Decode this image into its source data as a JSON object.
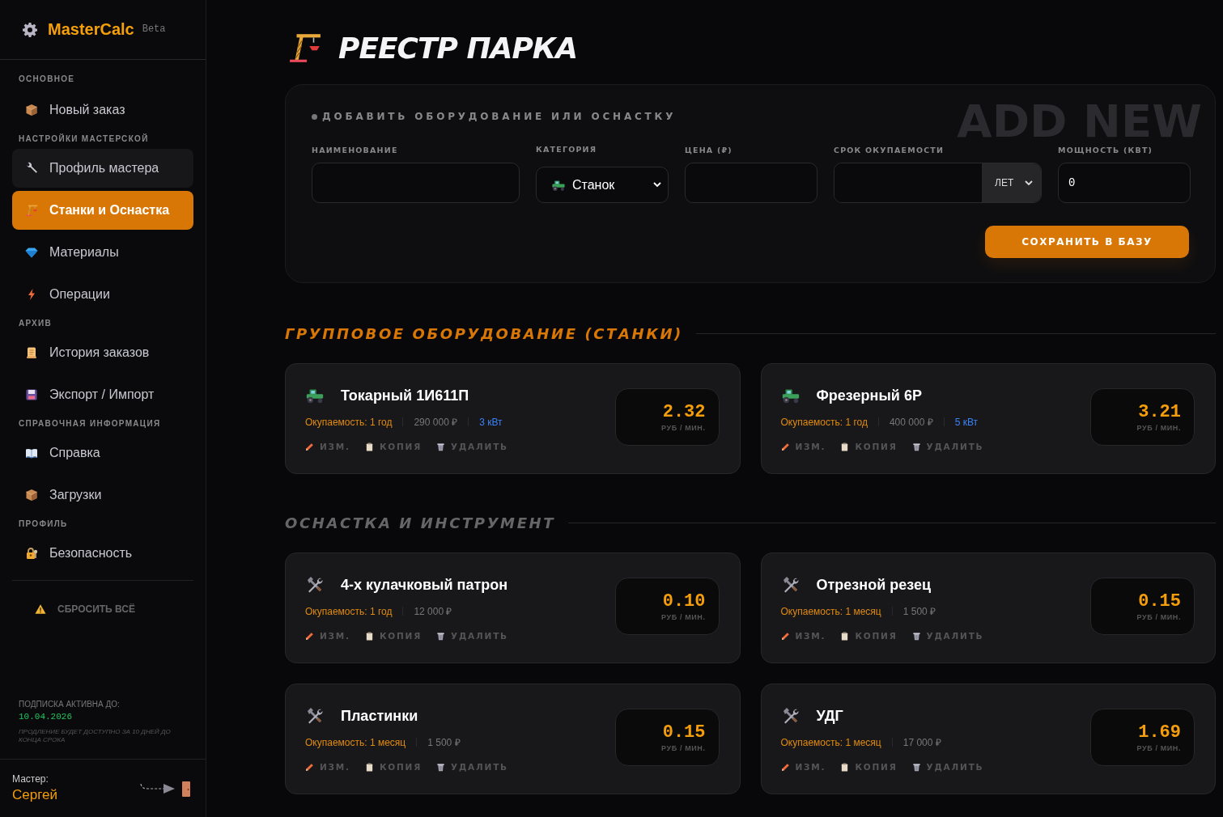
{
  "brand": {
    "name": "MasterCalc",
    "badge": "Beta"
  },
  "sidebar": {
    "sections": [
      {
        "heading": "ОСНОВНОЕ",
        "items": [
          {
            "label": "Новый заказ",
            "kind": "box",
            "selected": false,
            "hovered": false
          }
        ]
      },
      {
        "heading": "НАСТРОЙКИ МАСТЕРСКОЙ",
        "items": [
          {
            "label": "Профиль мастера",
            "kind": "wrench",
            "selected": false,
            "hovered": true
          },
          {
            "label": "Станки и Оснастка",
            "kind": "crane",
            "selected": true,
            "hovered": false
          },
          {
            "label": "Материалы",
            "kind": "gem",
            "selected": false,
            "hovered": false
          },
          {
            "label": "Операции",
            "kind": "lightning",
            "selected": false,
            "hovered": false
          }
        ]
      },
      {
        "heading": "АРХИВ",
        "items": [
          {
            "label": "История заказов",
            "kind": "scroll",
            "selected": false,
            "hovered": false
          },
          {
            "label": "Экспорт / Импорт",
            "kind": "floppy",
            "selected": false,
            "hovered": false
          }
        ]
      },
      {
        "heading": "СПРАВОЧНАЯ ИНФОРМАЦИЯ",
        "items": [
          {
            "label": "Справка",
            "kind": "book",
            "selected": false,
            "hovered": false
          },
          {
            "label": "Загрузки",
            "kind": "box",
            "selected": false,
            "hovered": false
          }
        ]
      },
      {
        "heading": "ПРОФИЛЬ",
        "items": [
          {
            "label": "Безопасность",
            "kind": "lock",
            "selected": false,
            "hovered": false
          }
        ]
      }
    ],
    "reset_button": "СБРОСИТЬ ВСЁ",
    "subscription": {
      "label": "ПОДПИСКА АКТИВНА ДО:",
      "date": "10.04.2026",
      "note": "ПРОДЛЕНИЕ БУДЕТ ДОСТУПНО ЗА 10 ДНЕЙ ДО КОНЦА СРОКА"
    },
    "user": {
      "label": "Мастер:",
      "name": "Сергей"
    }
  },
  "page": {
    "title": "РЕЕСТР ПАРКА"
  },
  "add_form": {
    "title": "ДОБАВИТЬ ОБОРУДОВАНИЕ ИЛИ ОСНАСТКУ",
    "watermark": "ADD NEW",
    "fields": [
      {
        "kind": "text",
        "label": "НАИМЕНОВАНИЕ"
      },
      {
        "kind": "select",
        "label": "КАТЕГОРИЯ",
        "value": "Станок"
      },
      {
        "kind": "text",
        "label": "ЦЕНА (₽)"
      },
      {
        "kind": "unit",
        "label": "СРОК ОКУПАЕМОСТИ",
        "unit": "ЛЕТ"
      },
      {
        "kind": "text",
        "label": "МОЩНОСТЬ (КВТ)",
        "value": "0"
      }
    ],
    "save_button": "СОХРАНИТЬ В БАЗУ"
  },
  "groups": [
    {
      "title": "ГРУППОВОЕ ОБОРУДОВАНИЕ (СТАНКИ)",
      "highlighted": true,
      "items": [
        {
          "kind": "machine",
          "name": "Токарный 1И611П",
          "payback": "Окупаемость: 1 год",
          "price": "290 000 ₽",
          "power": "3 кВт",
          "rate": "2.32",
          "rate_unit": "РУБ / МИН.",
          "actions": [
            "ИЗМ.",
            "КОПИЯ",
            "УДАЛИТЬ"
          ]
        },
        {
          "kind": "machine",
          "name": "Фрезерный 6Р",
          "payback": "Окупаемость: 1 год",
          "price": "400 000 ₽",
          "power": "5 кВт",
          "rate": "3.21",
          "rate_unit": "РУБ / МИН.",
          "actions": [
            "ИЗМ.",
            "КОПИЯ",
            "УДАЛИТЬ"
          ]
        }
      ]
    },
    {
      "title": "ОСНАСТКА И ИНСТРУМЕНТ",
      "highlighted": false,
      "items": [
        {
          "kind": "tool",
          "name": "4-х кулачковый патрон",
          "payback": "Окупаемость: 1 год",
          "price": "12 000 ₽",
          "rate": "0.10",
          "rate_unit": "РУБ / МИН.",
          "actions": [
            "ИЗМ.",
            "КОПИЯ",
            "УДАЛИТЬ"
          ]
        },
        {
          "kind": "tool",
          "name": "Отрезной резец",
          "payback": "Окупаемость: 1 месяц",
          "price": "1 500 ₽",
          "rate": "0.15",
          "rate_unit": "РУБ / МИН.",
          "actions": [
            "ИЗМ.",
            "КОПИЯ",
            "УДАЛИТЬ"
          ]
        },
        {
          "kind": "tool",
          "name": "Пластинки",
          "payback": "Окупаемость: 1 месяц",
          "price": "1 500 ₽",
          "rate": "0.15",
          "rate_unit": "РУБ / МИН.",
          "actions": [
            "ИЗМ.",
            "КОПИЯ",
            "УДАЛИТЬ"
          ]
        },
        {
          "kind": "tool",
          "name": "УДГ",
          "payback": "Окупаемость: 1 месяц",
          "price": "17 000 ₽",
          "rate": "1.69",
          "rate_unit": "РУБ / МИН.",
          "actions": [
            "ИЗМ.",
            "КОПИЯ",
            "УДАЛИТЬ"
          ]
        }
      ]
    }
  ]
}
